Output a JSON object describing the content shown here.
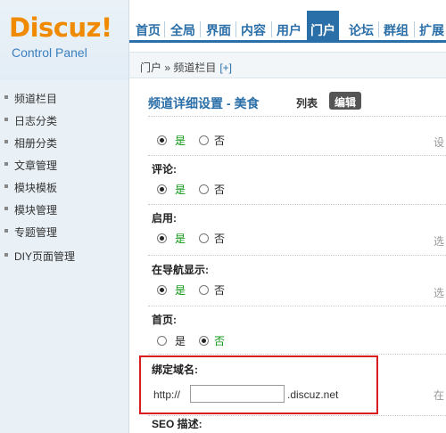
{
  "logo": {
    "mark": "Discuz!",
    "subtitle": "Control Panel"
  },
  "topnav": {
    "tabs": [
      "首页",
      "全局",
      "界面",
      "内容",
      "用户",
      "门户",
      "论坛",
      "群组",
      "扩展"
    ],
    "active": "门户"
  },
  "breadcrumb": {
    "path": "门户 » 频道栏目",
    "add": "[+]"
  },
  "sidebar": {
    "items": [
      "频道栏目",
      "日志分类",
      "相册分类",
      "文章管理",
      "模块模板",
      "模块管理",
      "专题管理",
      "DIY页面管理"
    ]
  },
  "main": {
    "title": "频道详细设置 - 美食",
    "tab_list": "列表",
    "tab_edit": "编辑",
    "fields": [
      {
        "label": "",
        "yes": "是",
        "no": "否",
        "value": "yes",
        "hint": "设"
      },
      {
        "label": "评论:",
        "yes": "是",
        "no": "否",
        "value": "yes",
        "hint": ""
      },
      {
        "label": "启用:",
        "yes": "是",
        "no": "否",
        "value": "yes",
        "hint": "选"
      },
      {
        "label": "在导航显示:",
        "yes": "是",
        "no": "否",
        "value": "yes",
        "hint": "选"
      },
      {
        "label": "首页:",
        "yes": "是",
        "no": "否",
        "value": "no",
        "hint": ""
      }
    ],
    "domain": {
      "label": "绑定域名:",
      "prefix": "http://",
      "value": "",
      "suffix": ".discuz.net",
      "hint": "在"
    },
    "seo_label": "SEO 描述:"
  },
  "colors": {
    "accent": "#2b6fa8",
    "highlight": "#d81e1e",
    "checked_green": "#09960f",
    "logo_orange": "#f08a00"
  }
}
